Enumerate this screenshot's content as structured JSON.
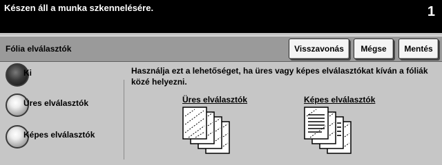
{
  "status": {
    "message": "Készen áll a munka szkennelésére.",
    "page_count": "1"
  },
  "title": "Fólia elválasztók",
  "buttons": {
    "undo": "Visszavonás",
    "cancel": "Mégse",
    "save": "Mentés"
  },
  "options": [
    {
      "label": "Ki",
      "selected": true
    },
    {
      "label": "Üres elválasztók",
      "selected": false
    },
    {
      "label": "Képes elválasztók",
      "selected": false
    }
  ],
  "description": "Használja ezt a lehetőséget, ha üres vagy képes elválasztókat kíván a fóliák közé helyezni.",
  "examples": {
    "blank_label": "Üres elválasztók",
    "image_label": "Képes elválasztók"
  },
  "icons": {
    "blank": "blank-separator-stack-icon",
    "image": "image-separator-stack-icon"
  }
}
